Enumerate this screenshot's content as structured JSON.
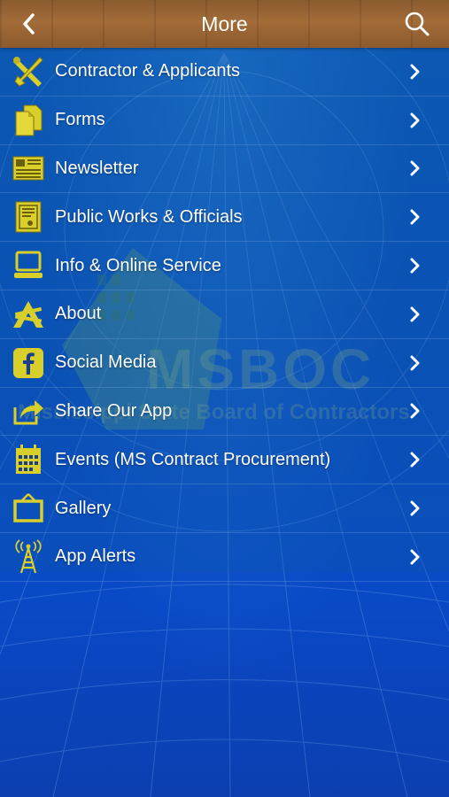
{
  "header": {
    "title": "More",
    "back_icon": "chevron-left-icon",
    "search_icon": "search-icon"
  },
  "menu": {
    "items": [
      {
        "label": "Contractor & Applicants",
        "icon": "tools-icon"
      },
      {
        "label": "Forms",
        "icon": "documents-icon"
      },
      {
        "label": "Newsletter",
        "icon": "newspaper-icon"
      },
      {
        "label": "Public Works & Officials",
        "icon": "certificate-icon"
      },
      {
        "label": "Info & Online Service",
        "icon": "computer-icon"
      },
      {
        "label": "About",
        "icon": "app-logo-icon"
      },
      {
        "label": "Social Media",
        "icon": "facebook-icon"
      },
      {
        "label": "Share Our App",
        "icon": "share-icon"
      },
      {
        "label": "Events (MS Contract Procurement)",
        "icon": "calendar-icon"
      },
      {
        "label": "Gallery",
        "icon": "easel-icon"
      },
      {
        "label": "App Alerts",
        "icon": "antenna-icon"
      }
    ]
  },
  "watermark": {
    "logo_text": "MSBOC",
    "tagline": "Mississippi State Board of Contractors"
  },
  "colors": {
    "icon": "#d8cf2a",
    "header_wood": "#9a6535",
    "background_blue": "#0a49c6"
  }
}
